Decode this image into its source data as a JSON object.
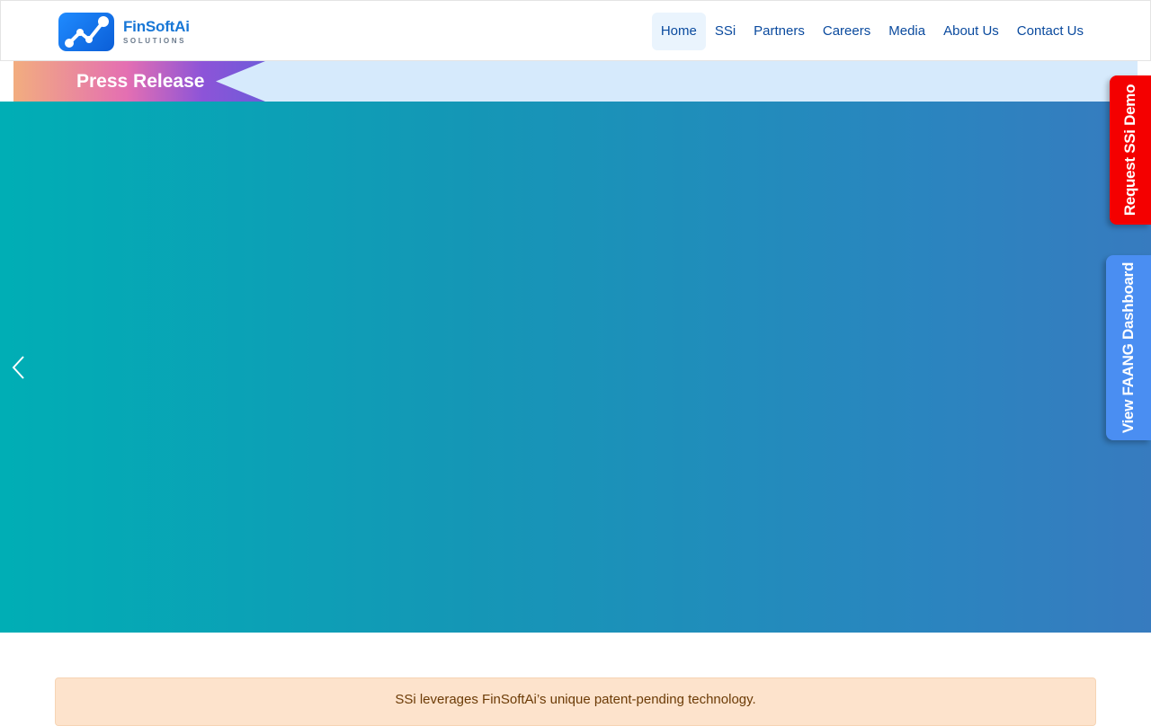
{
  "brand": {
    "name": "FinSoftAi",
    "sub": "SOLUTIONS",
    "accent": "#1877d6"
  },
  "nav": {
    "items": [
      {
        "label": "Home",
        "active": true
      },
      {
        "label": "SSi"
      },
      {
        "label": "Partners"
      },
      {
        "label": "Careers"
      },
      {
        "label": "Media"
      },
      {
        "label": "About Us"
      },
      {
        "label": "Contact Us"
      }
    ]
  },
  "press": {
    "label": "Press Release"
  },
  "hero": {
    "prev_icon": "chevron-left-icon"
  },
  "side_tabs": {
    "demo": "Request SSi Demo",
    "demo_color": "#f40000",
    "faang": "View FAANG Dashboard",
    "faang_color": "#4a8ef2"
  },
  "notice": {
    "text": "SSi leverages FinSoftAi’s unique patent-pending technology."
  }
}
